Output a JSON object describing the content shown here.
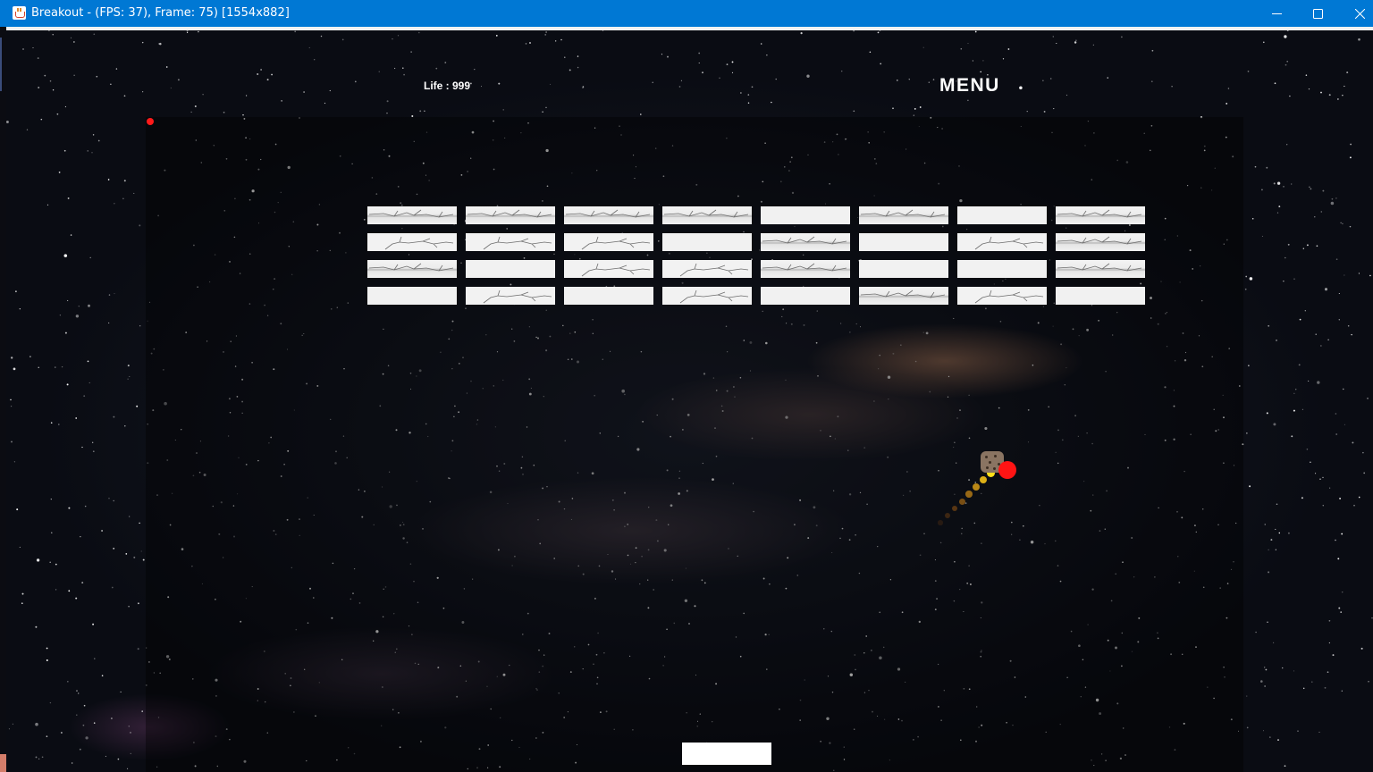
{
  "window": {
    "title": "Breakout - (FPS: 37), Frame: 75) [1554x882]",
    "controls": [
      "minimize",
      "maximize",
      "close"
    ]
  },
  "hud": {
    "life_label": "Life : 999",
    "menu_label": "MENU"
  },
  "game": {
    "brick_grid": {
      "rows": 4,
      "columns": 8,
      "bricks": [
        [
          "cracked-1",
          "cracked-1",
          "cracked-1",
          "cracked-1",
          "intact",
          "cracked-1",
          "intact",
          "cracked-1"
        ],
        [
          "cracked-2",
          "cracked-2",
          "cracked-2",
          "intact",
          "cracked-1",
          "intact",
          "cracked-2",
          "cracked-1"
        ],
        [
          "cracked-1",
          "intact",
          "cracked-2",
          "cracked-2",
          "cracked-1",
          "intact",
          "intact",
          "cracked-1"
        ],
        [
          "intact",
          "cracked-2",
          "intact",
          "cracked-2",
          "intact",
          "cracked-1",
          "cracked-2",
          "intact"
        ]
      ]
    },
    "ball": {
      "color": "#ff1414"
    },
    "ball_trail_colors": [
      "#ffe01a",
      "#f2c018",
      "#e0a417",
      "#cc8a16",
      "#b87315",
      "#9a5a14",
      "#7a4412",
      "#5a3010"
    ],
    "powerup": {
      "icon": "cookie-icon",
      "color": "#8a7462"
    },
    "paddle": {
      "color": "#ffffff"
    },
    "marker_dot_color": "#ff1a1a"
  },
  "colors": {
    "titlebar": "#0078d4",
    "background": "#0a0c13",
    "brick": "#f1f1f1"
  }
}
